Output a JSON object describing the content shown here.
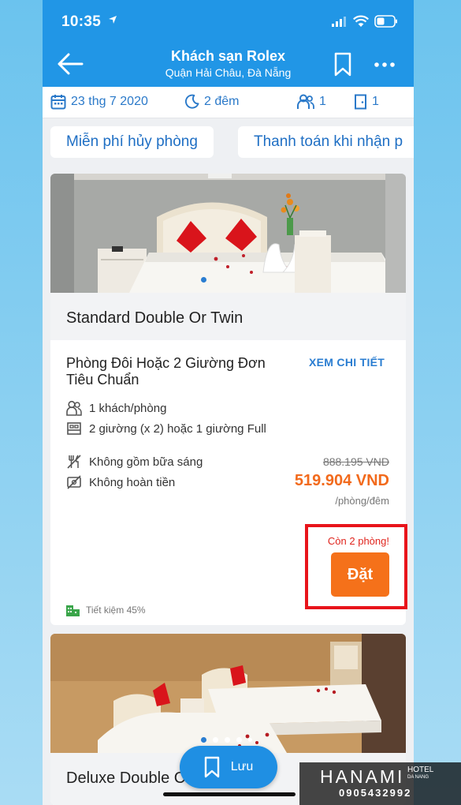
{
  "status_bar": {
    "time": "10:35"
  },
  "header": {
    "title": "Khách sạn Rolex",
    "subtitle": "Quận Hải Châu, Đà Nẵng"
  },
  "search_bar": {
    "date": "23 thg 7 2020",
    "nights": "2 đêm",
    "guests": "1",
    "rooms": "1"
  },
  "filters": [
    "Miễn phí hủy phòng",
    "Thanh toán khi nhận p"
  ],
  "rooms": [
    {
      "type": "Standard Double Or Twin",
      "name": "Phòng Đôi Hoặc 2 Giường Đơn Tiêu Chuẩn",
      "detail_link": "XEM CHI TIẾT",
      "occupancy": "1 khách/phòng",
      "beds": "2 giường (x 2) hoặc 1 giường Full",
      "breakfast": "Không gồm bữa sáng",
      "refund": "Không hoàn tiền",
      "old_price": "888.195 VND",
      "price": "519.904 VND",
      "price_unit": "/phòng/đêm",
      "availability": "Còn 2 phòng!",
      "book_label": "Đặt",
      "savings": "Tiết kiệm 45%"
    },
    {
      "type": "Deluxe Double C"
    }
  ],
  "save_button": {
    "label": "Lưu"
  },
  "watermark": {
    "brand": "HANAMI",
    "brand_sub": "HOTEL",
    "brand_sub2": "DA NANG",
    "phone": "0905432992"
  },
  "colors": {
    "primary": "#2196e6",
    "price": "#f26a1c",
    "book": "#f5711a",
    "alert": "#e0251e",
    "highlight_box": "#e8141b"
  }
}
